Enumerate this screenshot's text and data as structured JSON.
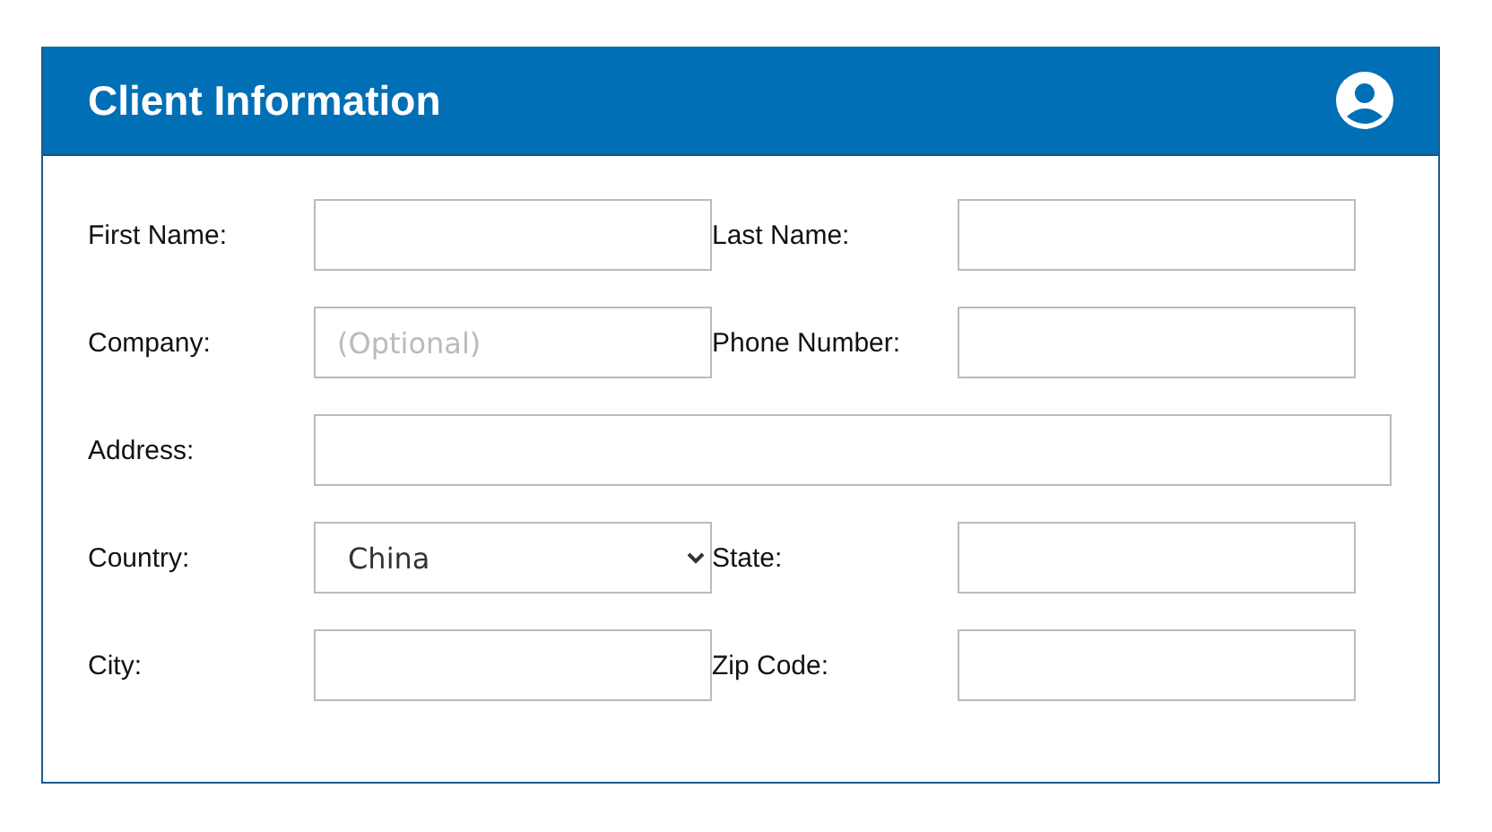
{
  "header": {
    "title": "Client Information"
  },
  "fields": [
    {
      "label": "First Name:",
      "kind": "text"
    },
    {
      "label": "Last Name:",
      "kind": "text"
    },
    {
      "label": "Company:",
      "kind": "text",
      "placeholder": "(Optional)"
    },
    {
      "label": "Phone Number:",
      "kind": "text"
    },
    {
      "label": "Address:",
      "kind": "wide"
    },
    {
      "label": "Country:",
      "kind": "select",
      "value": "China"
    },
    {
      "label": "State:",
      "kind": "text"
    },
    {
      "label": "City:",
      "kind": "text"
    },
    {
      "label": "Zip Code:",
      "kind": "text"
    }
  ]
}
